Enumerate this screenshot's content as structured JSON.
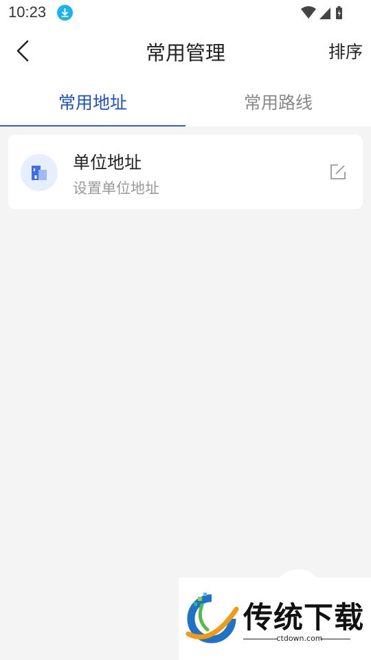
{
  "status_bar": {
    "time": "10:23"
  },
  "header": {
    "title": "常用管理",
    "sort_label": "排序"
  },
  "tabs": [
    {
      "label": "常用地址",
      "active": true
    },
    {
      "label": "常用路线",
      "active": false
    }
  ],
  "address_card": {
    "title": "单位地址",
    "subtitle": "设置单位地址"
  },
  "watermark": {
    "brand": "传统下载",
    "url": "ctdown.com"
  },
  "colors": {
    "accent": "#2f5fd6",
    "background": "#f4f4f4",
    "download_icon": "#19b3f0"
  }
}
